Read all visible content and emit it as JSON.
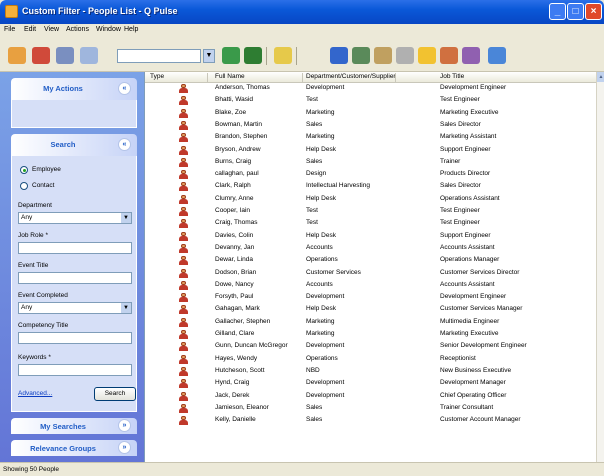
{
  "window": {
    "title": "Custom Filter - People List - Q Pulse"
  },
  "menu": [
    "File",
    "Edit",
    "View",
    "Actions",
    "Window",
    "Help"
  ],
  "toolbar": {
    "combo_value": ""
  },
  "sidebar": {
    "my_actions": {
      "label": "My Actions",
      "chevron": "«"
    },
    "search": {
      "label": "Search",
      "chevron": "«",
      "radios": [
        {
          "label": "Employee",
          "checked": true
        },
        {
          "label": "Contact",
          "checked": false
        }
      ],
      "department_label": "Department",
      "department_value": "Any",
      "job_role_label": "Job Role *",
      "job_role_value": "",
      "event_title_label": "Event Title",
      "event_title_value": "",
      "event_completed_label": "Event Completed",
      "event_completed_value": "Any",
      "competency_title_label": "Competency Title",
      "competency_title_value": "",
      "keywords_label": "Keywords *",
      "keywords_value": "",
      "advanced_link": "Advanced...",
      "search_button": "Search"
    },
    "my_searches": {
      "label": "My Searches",
      "chevron": "»"
    },
    "relevance_groups": {
      "label": "Relevance Groups",
      "chevron": "»"
    }
  },
  "grid": {
    "columns": [
      "Type",
      "Full Name",
      "Department/Customer/Supplier",
      "Job Title"
    ],
    "rows": [
      [
        "Anderson, Thomas",
        "Development",
        "Development Engineer"
      ],
      [
        "Bhatti, Wasid",
        "Test",
        "Test Engineer"
      ],
      [
        "Blake, Zoe",
        "Marketing",
        "Marketing Executive"
      ],
      [
        "Bowman, Martin",
        "Sales",
        "Sales Director"
      ],
      [
        "Brandon, Stephen",
        "Marketing",
        "Marketing Assistant"
      ],
      [
        "Bryson, Andrew",
        "Help Desk",
        "Support Engineer"
      ],
      [
        "Burns, Craig",
        "Sales",
        "Trainer"
      ],
      [
        "callaghan, paul",
        "Design",
        "Products Director"
      ],
      [
        "Clark, Ralph",
        "Intellectual Harvesting",
        "Sales Director"
      ],
      [
        "Clumry, Anne",
        "Help Desk",
        "Operations Assistant"
      ],
      [
        "Cooper, Iain",
        "Test",
        "Test Engineer"
      ],
      [
        "Craig, Thomas",
        "Test",
        "Test Engineer"
      ],
      [
        "Davies, Colin",
        "Help Desk",
        "Support Engineer"
      ],
      [
        "Devanny, Jan",
        "Accounts",
        "Accounts Assistant"
      ],
      [
        "Dewar, Linda",
        "Operations",
        "Operations Manager"
      ],
      [
        "Dodson, Brian",
        "Customer Services",
        "Customer Services Director"
      ],
      [
        "Dowe, Nancy",
        "Accounts",
        "Accounts Assistant"
      ],
      [
        "Forsyth, Paul",
        "Development",
        "Development Engineer"
      ],
      [
        "Gahagan, Mark",
        "Help Desk",
        "Customer Services Manager"
      ],
      [
        "Gallacher, Stephen",
        "Marketing",
        "Multimedia Engineer"
      ],
      [
        "Gilland, Clare",
        "Marketing",
        "Marketing Executive"
      ],
      [
        "Gunn, Duncan McGregor",
        "Development",
        "Senior Development Engineer"
      ],
      [
        "Hayes, Wendy",
        "Operations",
        "Receptionist"
      ],
      [
        "Hutcheson, Scott",
        "NBD",
        "New Business Executive"
      ],
      [
        "Hynd, Craig",
        "Development",
        "Development Manager"
      ],
      [
        "Jack, Derek",
        "Development",
        "Chief Operating Officer"
      ],
      [
        "Jamieson, Eleanor",
        "Sales",
        "Trainer Consultant"
      ],
      [
        "Kelly, Danielle",
        "Sales",
        "Customer Account Manager"
      ]
    ]
  },
  "status": {
    "text": "Showing 50 People"
  },
  "colors": {
    "titlebar": "#0a58d8",
    "sidebar": "#6375d6",
    "panel_header_text": "#215dc6"
  }
}
